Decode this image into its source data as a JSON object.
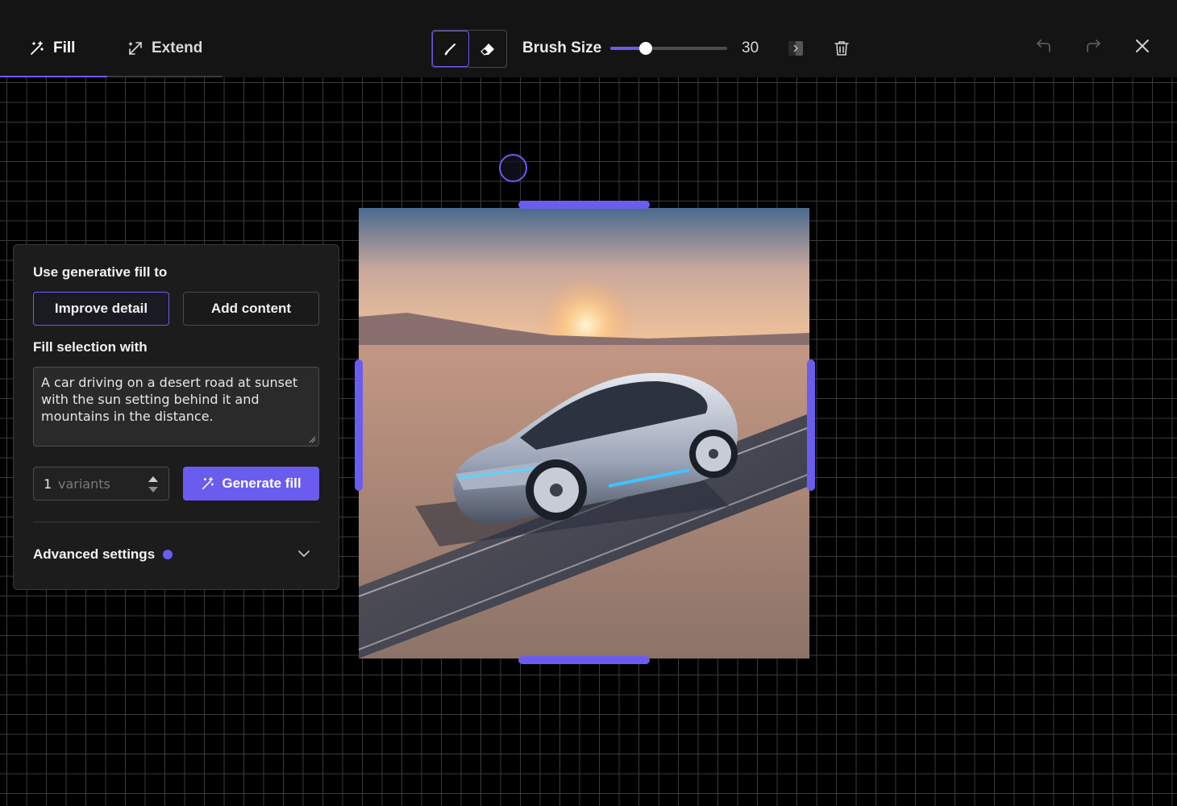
{
  "toolbar": {
    "tabs": [
      {
        "label": "Fill",
        "icon": "magic-wand-icon",
        "active": true
      },
      {
        "label": "Extend",
        "icon": "expand-arrows-icon",
        "active": false
      }
    ],
    "brush_tool_icon": "brush-icon",
    "eraser_tool_icon": "eraser-icon",
    "brush_size_label": "Brush Size",
    "brush_size_value": "30",
    "brush_size_fraction": 0.3,
    "invert_icon": "invert-mask-icon",
    "delete_icon": "trash-icon",
    "undo_icon": "undo-icon",
    "redo_icon": "redo-icon",
    "close_icon": "close-icon"
  },
  "panel": {
    "use_label": "Use generative fill to",
    "options": [
      "Improve detail",
      "Add content"
    ],
    "selected_option": "Improve detail",
    "fill_label": "Fill selection with",
    "prompt": "A car driving on a desert road at sunset with the sun setting behind it and mountains in the distance.",
    "variants_value": "1",
    "variants_unit": "variants",
    "generate_label": "Generate fill",
    "advanced_label": "Advanced settings"
  },
  "colors": {
    "accent": "#6b5cf0",
    "topbar_bg": "#141414",
    "panel_bg": "#1c1c1c"
  }
}
